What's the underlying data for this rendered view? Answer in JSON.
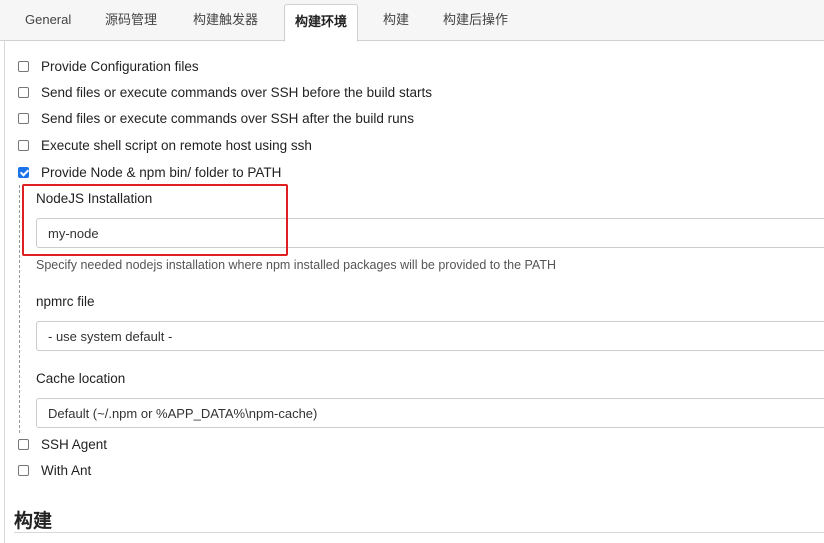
{
  "tabs": [
    {
      "label": "General",
      "active": false
    },
    {
      "label": "源码管理",
      "active": false
    },
    {
      "label": "构建触发器",
      "active": false
    },
    {
      "label": "构建环境",
      "active": true
    },
    {
      "label": "构建",
      "active": false
    },
    {
      "label": "构建后操作",
      "active": false
    }
  ],
  "build_env": {
    "options": [
      {
        "label": "Provide Configuration files",
        "checked": false
      },
      {
        "label": "Send files or execute commands over SSH before the build starts",
        "checked": false
      },
      {
        "label": "Send files or execute commands over SSH after the build runs",
        "checked": false
      },
      {
        "label": "Execute shell script on remote host using ssh",
        "checked": false
      },
      {
        "label": "Provide Node & npm bin/ folder to PATH",
        "checked": true
      },
      {
        "label": "SSH Agent",
        "checked": false
      },
      {
        "label": "With Ant",
        "checked": false
      }
    ],
    "node": {
      "installation_label": "NodeJS Installation",
      "installation_value": "my-node",
      "installation_help": "Specify needed nodejs installation where npm installed packages will be provided to the PATH",
      "npmrc_label": "npmrc file",
      "npmrc_value": "- use system default -",
      "cache_label": "Cache location",
      "cache_value": "Default (~/.npm or %APP_DATA%\\npm-cache)"
    }
  },
  "next_section": {
    "title": "构建"
  },
  "colors": {
    "accent": "#1a73e8",
    "highlight": "#e02020"
  }
}
